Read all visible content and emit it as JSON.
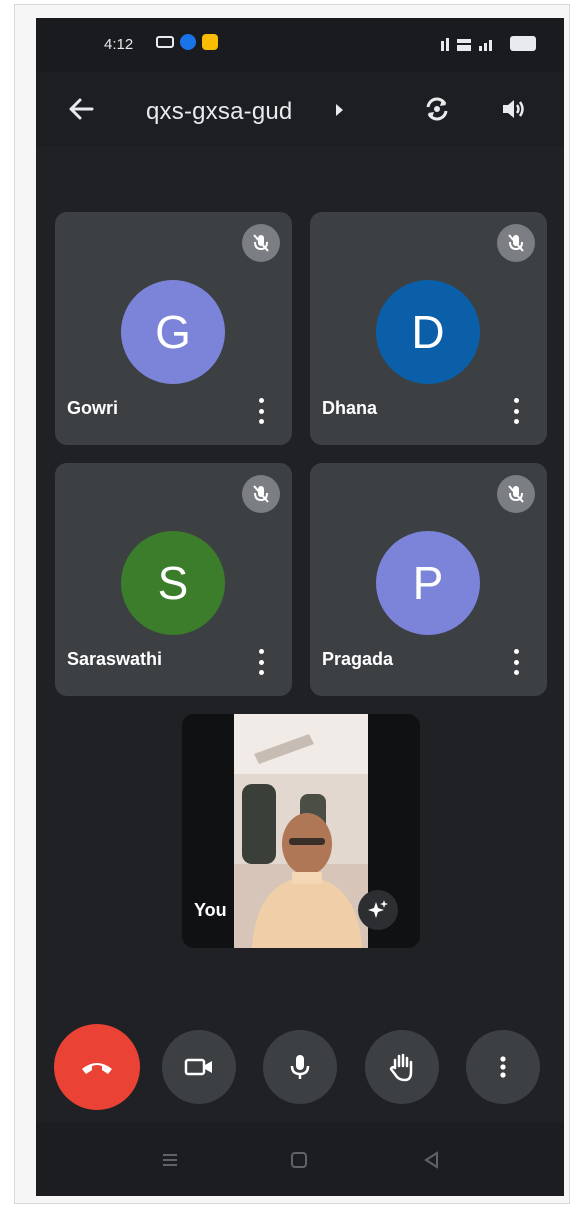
{
  "status_bar": {
    "time": "4:12",
    "signal_text": "Ba ·⁴ᴳ ⸽ᴬ"
  },
  "header": {
    "meeting_code": "qxs-gxsa-gud"
  },
  "participants": [
    {
      "initial": "G",
      "name": "Gowri",
      "avatar_color": "#7c84d9"
    },
    {
      "initial": "D",
      "name": "Dhana",
      "avatar_color": "#0b5fa8"
    },
    {
      "initial": "S",
      "name": "Saraswathi",
      "avatar_color": "#3b7d2a"
    },
    {
      "initial": "P",
      "name": "Pragada",
      "avatar_color": "#7c84d9"
    }
  ],
  "self_view": {
    "label": "You"
  },
  "controls": {
    "end_call_color": "#ea4335",
    "items": [
      "end-call",
      "camera",
      "microphone",
      "raise-hand",
      "more-options"
    ]
  },
  "colors": {
    "background": "#202124",
    "tile": "#3c4043",
    "control": "#3c4043"
  }
}
